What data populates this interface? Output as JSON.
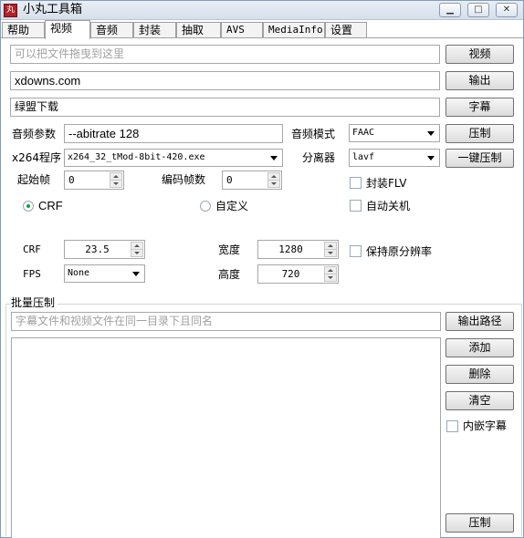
{
  "window": {
    "title": "小丸工具箱",
    "icon_text": "丸",
    "minimize": "▁",
    "maximize": "□",
    "close": "✕"
  },
  "tabs": [
    "帮助",
    "视频",
    "音频",
    "封装",
    "抽取",
    "AVS",
    "MediaInfo",
    "设置"
  ],
  "video": {
    "input_placeholder": "可以把文件拖曳到这里",
    "video_button": "视频",
    "output_value": "xdowns.com",
    "output_button": "输出",
    "subtitle_value": "绿盟下载",
    "subtitle_button": "字幕",
    "audio_params_label": "音频参数",
    "audio_params_value": "--abitrate 128",
    "audio_mode_label": "音频模式",
    "audio_mode_value": "FAAC",
    "compress_button": "压制",
    "x264_label": "x264程序",
    "x264_value": "x264_32_tMod-8bit-420.exe",
    "separator_label": "分离器",
    "separator_value": "lavf",
    "one_click_button": "一键压制",
    "start_frame_label": "起始帧",
    "start_frame_value": "0",
    "encode_frames_label": "编码帧数",
    "encode_frames_value": "0",
    "mux_flv_label": "封装FLV",
    "auto_shutdown_label": "自动关机",
    "mode_crf_label": "CRF",
    "mode_custom_label": "自定义",
    "crf_label": "CRF",
    "crf_value": "23.5",
    "width_label": "宽度",
    "width_value": "1280",
    "keep_res_label": "保持原分辨率",
    "fps_label": "FPS",
    "fps_value": "None",
    "height_label": "高度",
    "height_value": "720"
  },
  "batch": {
    "title": "批量压制",
    "hint_placeholder": "字幕文件和视频文件在同一目录下且同名",
    "output_path_button": "输出路径",
    "add_button": "添加",
    "delete_button": "删除",
    "clear_button": "清空",
    "embed_sub_label": "内嵌字幕",
    "compress_button": "压制"
  },
  "colors": {
    "accent_green": "#1d9b3a",
    "icon_red": "#b0222a"
  }
}
